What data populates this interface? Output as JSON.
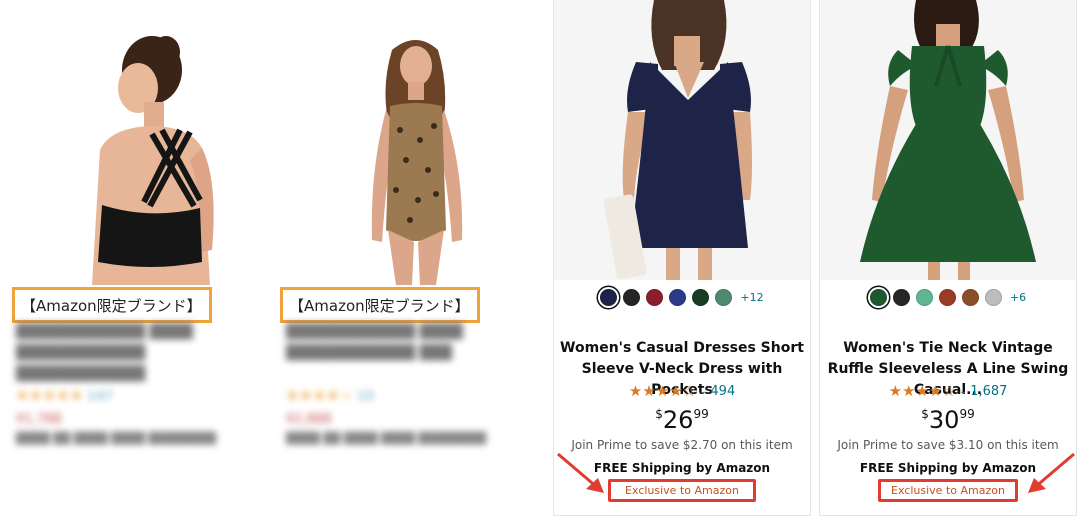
{
  "left_products": [
    {
      "brand_label": "【Amazon限定ブランド】",
      "title": "████████████ ████ ████████████ ████████████",
      "stars": "★★★★★",
      "review_count": "147",
      "price": "¥1,788",
      "note": "████ ██ ████ ████ ████████"
    },
    {
      "brand_label": "【Amazon限定ブランド】",
      "title": "████████████ ████ ████████████ ███",
      "stars": "★★★★☆",
      "review_count": "15",
      "price": "¥2,888",
      "note": "████ ██ ████ ████ ████████"
    }
  ],
  "right_products": [
    {
      "swatch_colors": [
        "#1e2447",
        "#262626",
        "#8a1f2c",
        "#2c3a8c",
        "#173d22",
        "#4f8a6e"
      ],
      "more_colors": "+12",
      "title": "Women's Casual Dresses Short Sleeve V-Neck Dress with Pockets",
      "stars": "★★★★☆",
      "rating_value": 4.3,
      "review_count": "494",
      "price_symbol": "$",
      "price_whole": "26",
      "price_fraction": "99",
      "prime_text": "Join Prime to save $2.70 on this item",
      "shipping": "FREE Shipping by Amazon",
      "exclusive": "Exclusive to Amazon"
    },
    {
      "swatch_colors": [
        "#1f5a2e",
        "#262626",
        "#5fb690",
        "#9a3b25",
        "#8a4f2a",
        "#bdbdbd"
      ],
      "more_colors": "+6",
      "title": "Women's Tie Neck Vintage Ruffle Sleeveless A Line Swing Casual...",
      "stars": "★★★★☆",
      "rating_value": 4.5,
      "review_count": "1,687",
      "price_symbol": "$",
      "price_whole": "30",
      "price_fraction": "99",
      "prime_text": "Join Prime to save $3.10 on this item",
      "shipping": "FREE Shipping by Amazon",
      "exclusive": "Exclusive to Amazon"
    }
  ],
  "colors": {
    "brand_box_border": "#f0a23b",
    "exclusive_box_border": "#e23b2f",
    "arrow": "#e23b2f",
    "star": "#de7921",
    "link": "#007185"
  }
}
